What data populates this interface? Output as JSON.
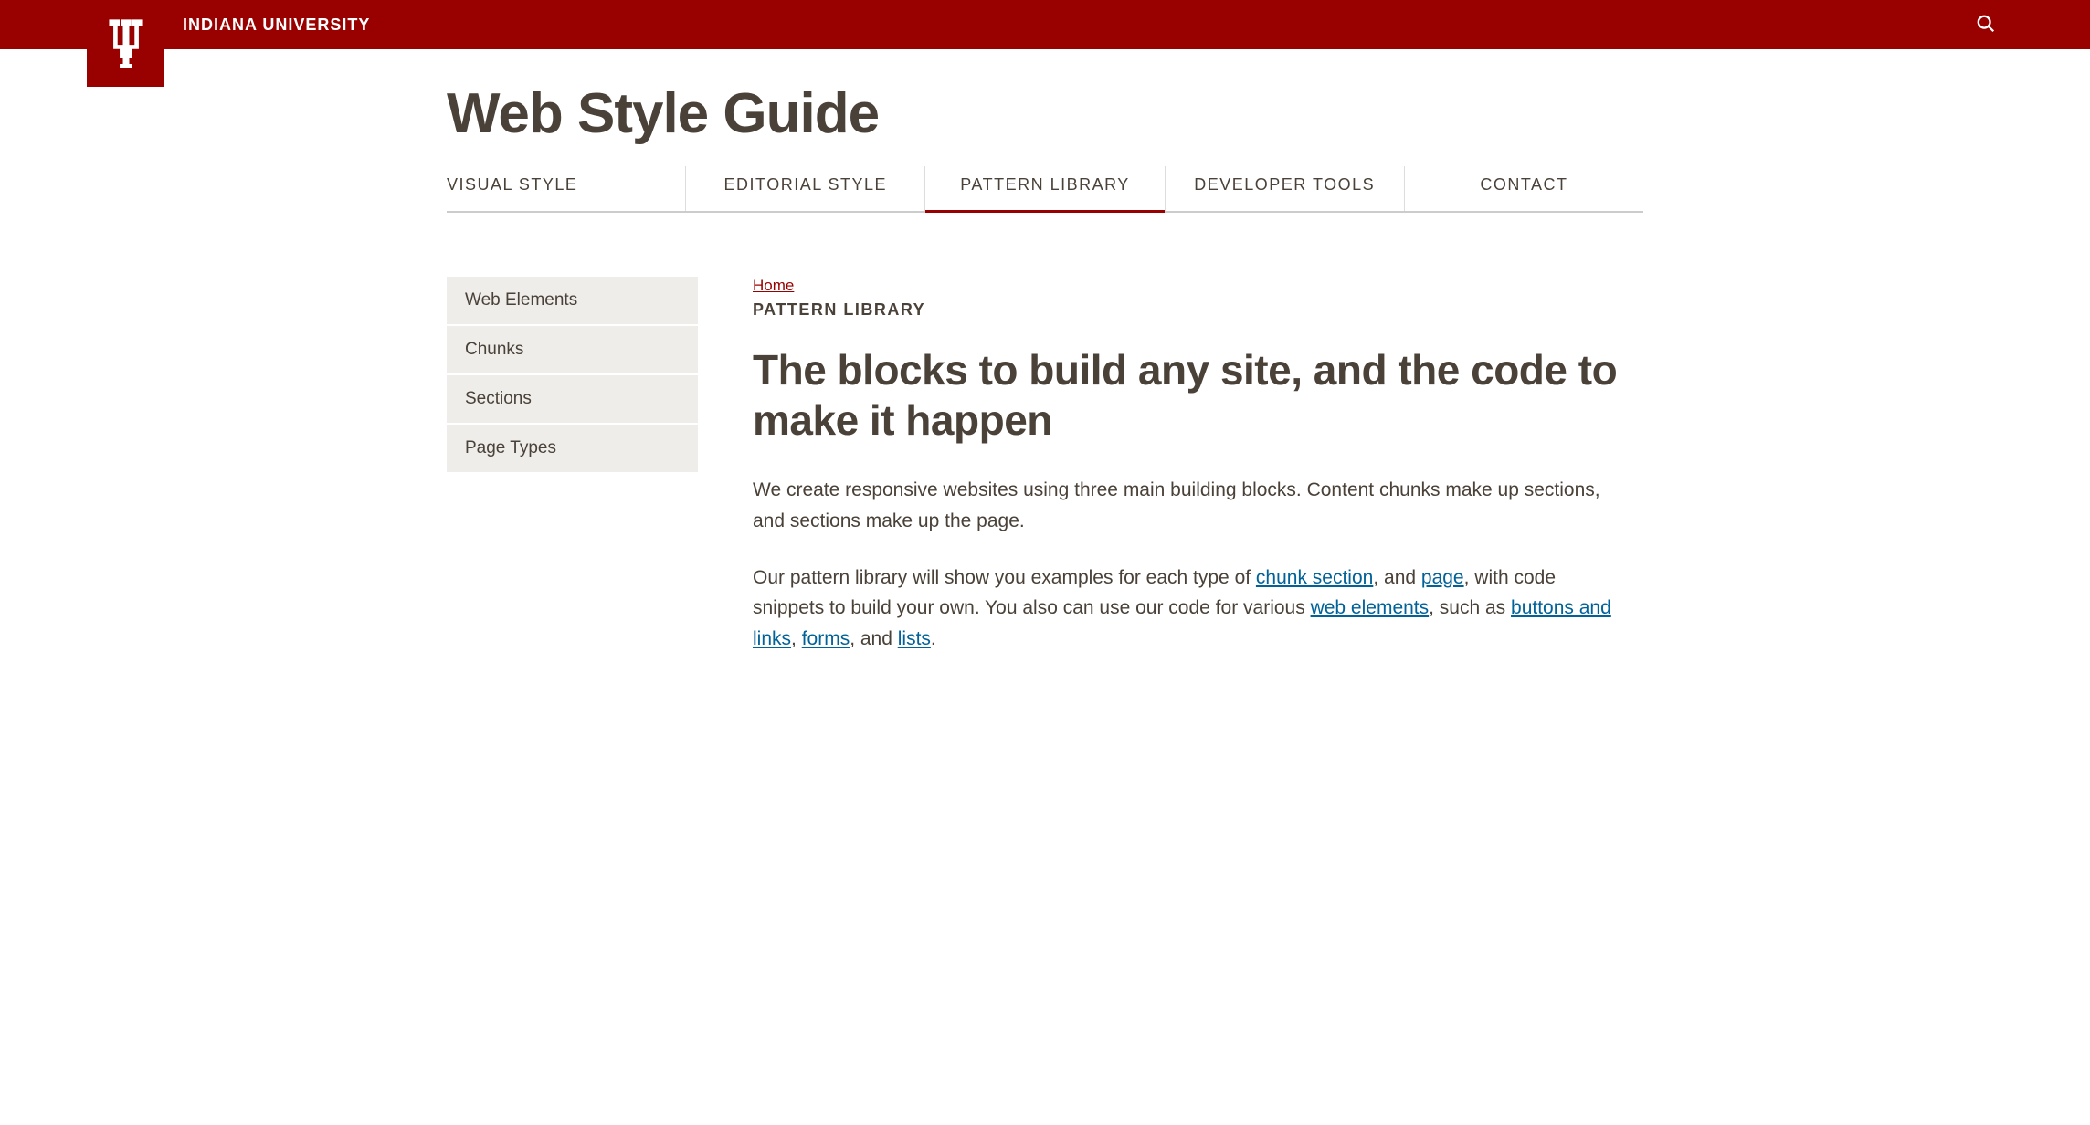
{
  "topbar": {
    "university": "INDIANA UNIVERSITY"
  },
  "site_title": "Web Style Guide",
  "nav": {
    "items": [
      {
        "label": "VISUAL STYLE",
        "active": false
      },
      {
        "label": "EDITORIAL STYLE",
        "active": false
      },
      {
        "label": "PATTERN LIBRARY",
        "active": true
      },
      {
        "label": "DEVELOPER TOOLS",
        "active": false
      },
      {
        "label": "CONTACT",
        "active": false
      }
    ]
  },
  "sidebar": {
    "items": [
      {
        "label": "Web Elements"
      },
      {
        "label": "Chunks"
      },
      {
        "label": "Sections"
      },
      {
        "label": "Page Types"
      }
    ]
  },
  "breadcrumb": {
    "home": "Home"
  },
  "content": {
    "section_label": "PATTERN LIBRARY",
    "heading": "The blocks to build any site, and the code to make it happen",
    "para1": "We create responsive websites using three main building blocks. Content chunks make up sections, and sections make up the page.",
    "para2_a": "Our pattern library will show you examples for each type of ",
    "link_chunk_section": "chunk section",
    "para2_b": ", and ",
    "link_page": "page",
    "para2_c": ", with code snippets to build your own. You also can use our code for various ",
    "link_web_elements": "web elements",
    "para2_d": ", such as ",
    "link_buttons": "buttons and links",
    "para2_e": ", ",
    "link_forms": "forms",
    "para2_f": ", and ",
    "link_lists": "lists",
    "para2_g": "."
  }
}
